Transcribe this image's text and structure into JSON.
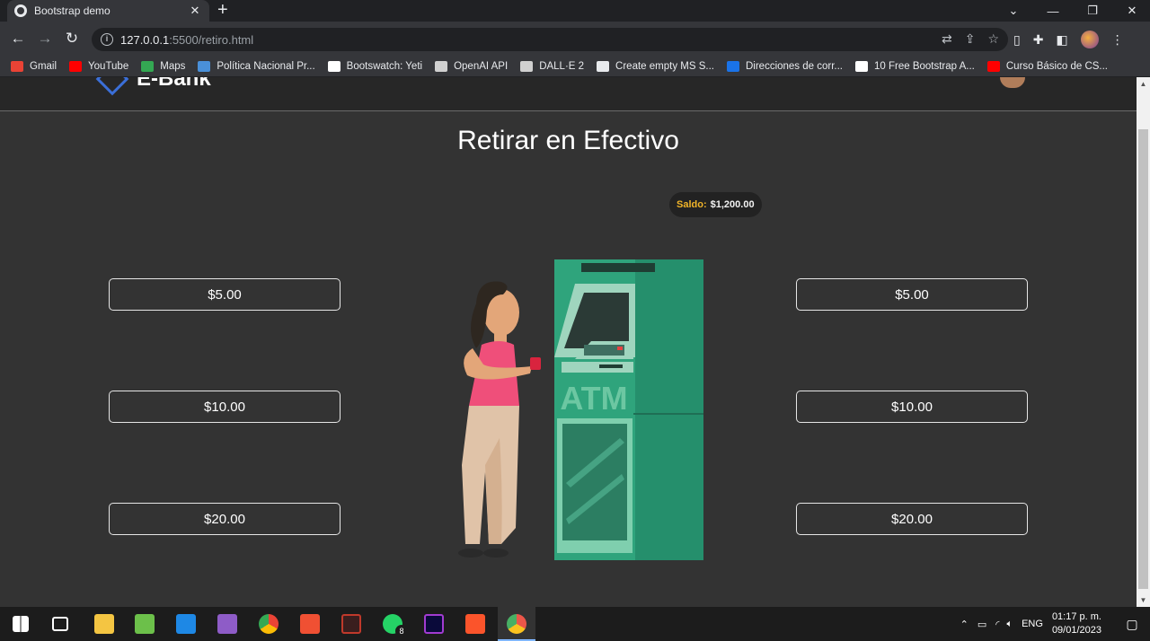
{
  "browser": {
    "tab_title": "Bootstrap demo",
    "tab_close": "✕",
    "new_tab": "+",
    "url_host": "127.0.0.1",
    "url_rest": ":5500/retiro.html",
    "window_controls": [
      "⌄",
      "—",
      "❐",
      "✕"
    ]
  },
  "bookmarks": [
    {
      "label": "Gmail",
      "color": "#ea4335"
    },
    {
      "label": "YouTube",
      "color": "#ff0000"
    },
    {
      "label": "Maps",
      "color": "#34a853"
    },
    {
      "label": "Política Nacional Pr...",
      "color": "#4a90d9"
    },
    {
      "label": "Bootswatch: Yeti",
      "color": "#ffffff"
    },
    {
      "label": "OpenAI API",
      "color": "#d0d0d0"
    },
    {
      "label": "DALL·E 2",
      "color": "#d0d0d0"
    },
    {
      "label": "Create empty MS S...",
      "color": "#e8eaed"
    },
    {
      "label": "Direcciones de corr...",
      "color": "#1a73e8"
    },
    {
      "label": "10 Free Bootstrap A...",
      "color": "#ffffff"
    },
    {
      "label": "Curso Básico de CS...",
      "color": "#ff0000"
    }
  ],
  "navbar": {
    "brand": "E-Bank"
  },
  "page": {
    "title": "Retirar en Efectivo",
    "saldo_label": "Saldo:",
    "saldo_value": "$1,200.00"
  },
  "amounts_left": [
    "$5.00",
    "$10.00",
    "$20.00"
  ],
  "amounts_right": [
    "$5.00",
    "$10.00",
    "$20.00"
  ],
  "atm_sign": "ATM",
  "taskbar": {
    "lang": "ENG",
    "time": "01:17 p. m.",
    "date": "09/01/2023",
    "whatsapp_badge": "8"
  }
}
